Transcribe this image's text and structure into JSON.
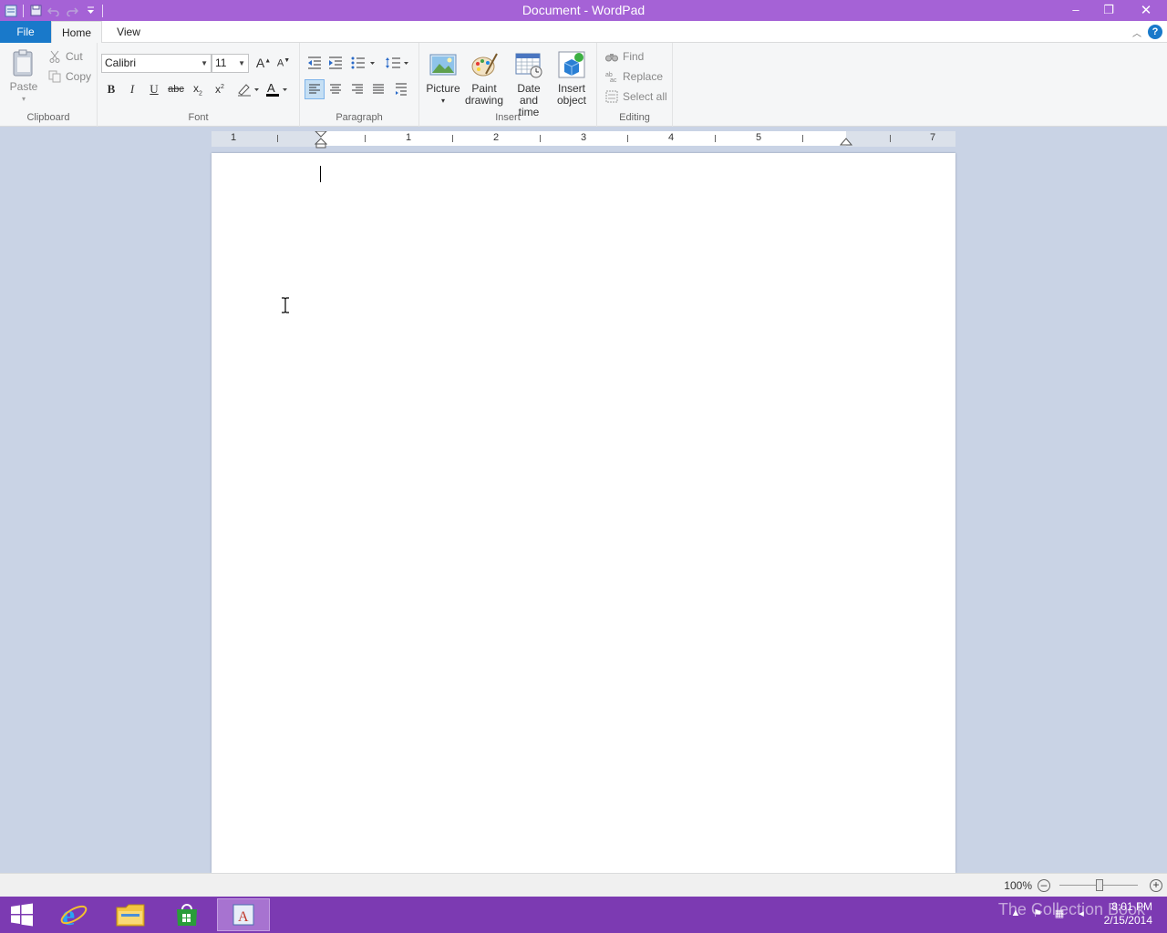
{
  "window": {
    "title": "Document - WordPad",
    "controls": {
      "minimize": "–",
      "maximize": "❐",
      "close": "✕"
    }
  },
  "ribbon_tabs": {
    "file": "File",
    "home": "Home",
    "view": "View"
  },
  "clipboard": {
    "label": "Clipboard",
    "paste": "Paste",
    "cut": "Cut",
    "copy": "Copy"
  },
  "font": {
    "label": "Font",
    "family": "Calibri",
    "size": "11"
  },
  "paragraph": {
    "label": "Paragraph"
  },
  "insert": {
    "label": "Insert",
    "picture": "Picture",
    "paint_drawing_1": "Paint",
    "paint_drawing_2": "drawing",
    "date_time_1": "Date and",
    "date_time_2": "time",
    "insert_object_1": "Insert",
    "insert_object_2": "object"
  },
  "editing": {
    "label": "Editing",
    "find": "Find",
    "replace": "Replace",
    "select_all": "Select all"
  },
  "ruler": {
    "numbers": [
      "1",
      "1",
      "2",
      "3",
      "4",
      "5",
      "7"
    ]
  },
  "status": {
    "zoom": "100%"
  },
  "taskbar": {
    "time": "8:01 PM",
    "date": "2/15/2014",
    "watermark": "The Collection Book"
  },
  "colors": {
    "titlebar": "#a562d6",
    "file_tab": "#1979ca",
    "taskbar": "#7c3ab2"
  }
}
